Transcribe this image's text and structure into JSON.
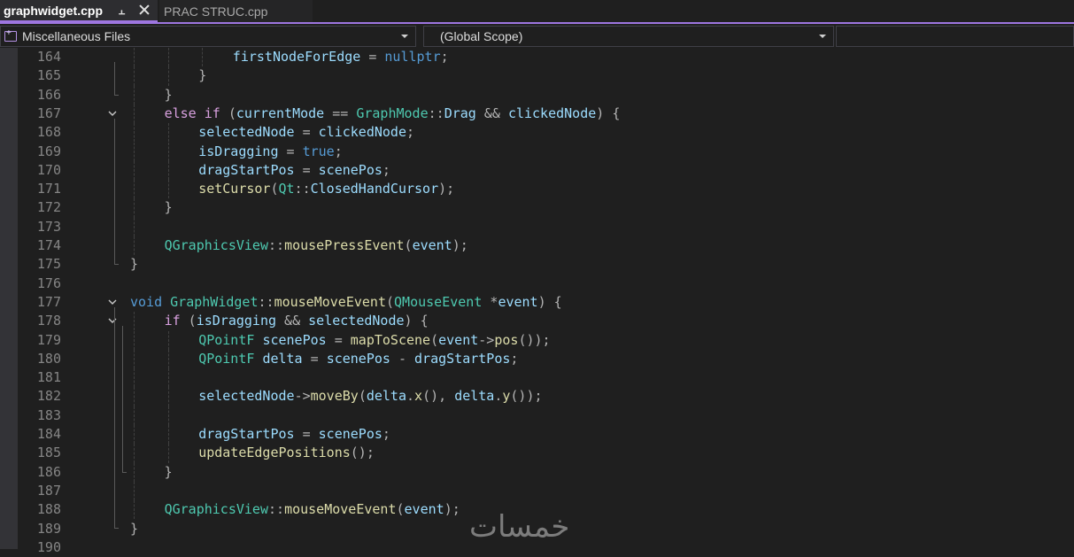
{
  "tabs": [
    {
      "label": "graphwidget.cpp",
      "active": true,
      "pinned": true
    },
    {
      "label": "PRAC STRUC.cpp",
      "active": false
    }
  ],
  "navbar": {
    "project": "Miscellaneous Files",
    "scope": "(Global Scope)",
    "member": ""
  },
  "colors": {
    "accent": "#9e76e0",
    "keyword": "#569cd6",
    "control": "#d8a0df",
    "function": "#dcdcaa",
    "type": "#4ec9b0",
    "variable": "#9cdcfe",
    "line_number": "#858585",
    "background": "#1f1f1f"
  },
  "code_lines": [
    {
      "n": "164",
      "indent": 3,
      "fold": false,
      "tokens": [
        [
          "v",
          "firstNodeForEdge"
        ],
        [
          "o",
          " = "
        ],
        [
          "k",
          "nullptr"
        ],
        [
          "o",
          ";"
        ]
      ]
    },
    {
      "n": "165",
      "indent": 2,
      "fold": false,
      "tokens": [
        [
          "o",
          "}"
        ]
      ]
    },
    {
      "n": "166",
      "indent": 1,
      "fold": false,
      "tokens": [
        [
          "o",
          "}"
        ]
      ]
    },
    {
      "n": "167",
      "indent": 1,
      "fold": true,
      "tokens": [
        [
          "c",
          "else"
        ],
        [
          "p",
          " "
        ],
        [
          "c",
          "if"
        ],
        [
          "o",
          " ("
        ],
        [
          "v",
          "currentMode"
        ],
        [
          "o",
          " == "
        ],
        [
          "t",
          "GraphMode"
        ],
        [
          "o",
          "::"
        ],
        [
          "v",
          "Drag"
        ],
        [
          "o",
          " && "
        ],
        [
          "v",
          "clickedNode"
        ],
        [
          "o",
          ") {"
        ]
      ]
    },
    {
      "n": "168",
      "indent": 2,
      "fold": false,
      "tokens": [
        [
          "v",
          "selectedNode"
        ],
        [
          "o",
          " = "
        ],
        [
          "v",
          "clickedNode"
        ],
        [
          "o",
          ";"
        ]
      ]
    },
    {
      "n": "169",
      "indent": 2,
      "fold": false,
      "tokens": [
        [
          "v",
          "isDragging"
        ],
        [
          "o",
          " = "
        ],
        [
          "k",
          "true"
        ],
        [
          "o",
          ";"
        ]
      ]
    },
    {
      "n": "170",
      "indent": 2,
      "fold": false,
      "tokens": [
        [
          "v",
          "dragStartPos"
        ],
        [
          "o",
          " = "
        ],
        [
          "v",
          "scenePos"
        ],
        [
          "o",
          ";"
        ]
      ]
    },
    {
      "n": "171",
      "indent": 2,
      "fold": false,
      "tokens": [
        [
          "f",
          "setCursor"
        ],
        [
          "o",
          "("
        ],
        [
          "t",
          "Qt"
        ],
        [
          "o",
          "::"
        ],
        [
          "v",
          "ClosedHandCursor"
        ],
        [
          "o",
          ");"
        ]
      ]
    },
    {
      "n": "172",
      "indent": 1,
      "fold": false,
      "tokens": [
        [
          "o",
          "}"
        ]
      ]
    },
    {
      "n": "173",
      "indent": 1,
      "fold": false,
      "tokens": []
    },
    {
      "n": "174",
      "indent": 1,
      "fold": false,
      "tokens": [
        [
          "t",
          "QGraphicsView"
        ],
        [
          "o",
          "::"
        ],
        [
          "f",
          "mousePressEvent"
        ],
        [
          "o",
          "("
        ],
        [
          "v",
          "event"
        ],
        [
          "o",
          ");"
        ]
      ]
    },
    {
      "n": "175",
      "indent": 0,
      "fold": false,
      "tokens": [
        [
          "o",
          "}"
        ]
      ]
    },
    {
      "n": "176",
      "indent": 0,
      "fold": false,
      "tokens": []
    },
    {
      "n": "177",
      "indent": 0,
      "fold": true,
      "tokens": [
        [
          "k",
          "void"
        ],
        [
          "p",
          " "
        ],
        [
          "t",
          "GraphWidget"
        ],
        [
          "o",
          "::"
        ],
        [
          "f",
          "mouseMoveEvent"
        ],
        [
          "o",
          "("
        ],
        [
          "t",
          "QMouseEvent"
        ],
        [
          "p",
          " "
        ],
        [
          "o",
          "*"
        ],
        [
          "v",
          "event"
        ],
        [
          "o",
          ") {"
        ]
      ]
    },
    {
      "n": "178",
      "indent": 1,
      "fold": true,
      "tokens": [
        [
          "c",
          "if"
        ],
        [
          "o",
          " ("
        ],
        [
          "v",
          "isDragging"
        ],
        [
          "o",
          " && "
        ],
        [
          "v",
          "selectedNode"
        ],
        [
          "o",
          ") {"
        ]
      ]
    },
    {
      "n": "179",
      "indent": 2,
      "fold": false,
      "tokens": [
        [
          "t",
          "QPointF"
        ],
        [
          "p",
          " "
        ],
        [
          "v",
          "scenePos"
        ],
        [
          "o",
          " = "
        ],
        [
          "f",
          "mapToScene"
        ],
        [
          "o",
          "("
        ],
        [
          "v",
          "event"
        ],
        [
          "o",
          "->"
        ],
        [
          "f",
          "pos"
        ],
        [
          "o",
          "());"
        ]
      ]
    },
    {
      "n": "180",
      "indent": 2,
      "fold": false,
      "tokens": [
        [
          "t",
          "QPointF"
        ],
        [
          "p",
          " "
        ],
        [
          "v",
          "delta"
        ],
        [
          "o",
          " = "
        ],
        [
          "v",
          "scenePos"
        ],
        [
          "o",
          " - "
        ],
        [
          "v",
          "dragStartPos"
        ],
        [
          "o",
          ";"
        ]
      ]
    },
    {
      "n": "181",
      "indent": 2,
      "fold": false,
      "tokens": []
    },
    {
      "n": "182",
      "indent": 2,
      "fold": false,
      "tokens": [
        [
          "v",
          "selectedNode"
        ],
        [
          "o",
          "->"
        ],
        [
          "f",
          "moveBy"
        ],
        [
          "o",
          "("
        ],
        [
          "v",
          "delta"
        ],
        [
          "o",
          "."
        ],
        [
          "f",
          "x"
        ],
        [
          "o",
          "(), "
        ],
        [
          "v",
          "delta"
        ],
        [
          "o",
          "."
        ],
        [
          "f",
          "y"
        ],
        [
          "o",
          "());"
        ]
      ]
    },
    {
      "n": "183",
      "indent": 2,
      "fold": false,
      "tokens": []
    },
    {
      "n": "184",
      "indent": 2,
      "fold": false,
      "tokens": [
        [
          "v",
          "dragStartPos"
        ],
        [
          "o",
          " = "
        ],
        [
          "v",
          "scenePos"
        ],
        [
          "o",
          ";"
        ]
      ]
    },
    {
      "n": "185",
      "indent": 2,
      "fold": false,
      "tokens": [
        [
          "f",
          "updateEdgePositions"
        ],
        [
          "o",
          "();"
        ]
      ]
    },
    {
      "n": "186",
      "indent": 1,
      "fold": false,
      "tokens": [
        [
          "o",
          "}"
        ]
      ]
    },
    {
      "n": "187",
      "indent": 1,
      "fold": false,
      "tokens": []
    },
    {
      "n": "188",
      "indent": 1,
      "fold": false,
      "tokens": [
        [
          "t",
          "QGraphicsView"
        ],
        [
          "o",
          "::"
        ],
        [
          "f",
          "mouseMoveEvent"
        ],
        [
          "o",
          "("
        ],
        [
          "v",
          "event"
        ],
        [
          "o",
          ");"
        ]
      ]
    },
    {
      "n": "189",
      "indent": 0,
      "fold": false,
      "tokens": [
        [
          "o",
          "}"
        ]
      ]
    },
    {
      "n": "190",
      "indent": 0,
      "fold": false,
      "tokens": []
    }
  ],
  "watermark": "خمسات"
}
